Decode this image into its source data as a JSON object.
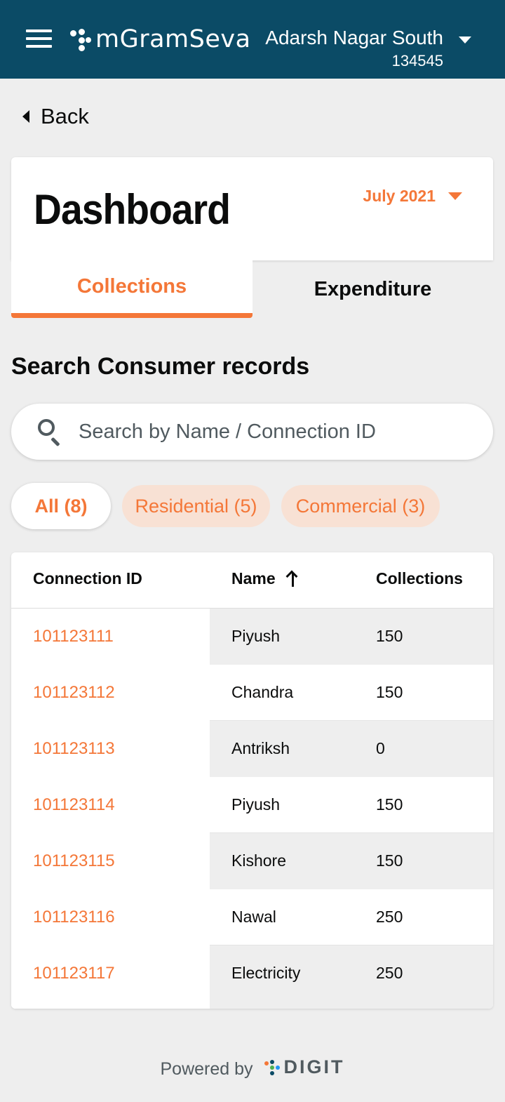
{
  "header": {
    "app_name": "mGramSeva",
    "tenant_name": "Adarsh Nagar South",
    "tenant_code": "134545"
  },
  "nav": {
    "back_label": "Back"
  },
  "dashboard": {
    "title": "Dashboard",
    "month": "July 2021"
  },
  "tabs": [
    {
      "label": "Collections",
      "active": true
    },
    {
      "label": "Expenditure",
      "active": false
    }
  ],
  "search": {
    "title": "Search Consumer records",
    "placeholder": "Search by Name / Connection ID"
  },
  "filters": [
    {
      "label": "All (8)",
      "selected": true
    },
    {
      "label": "Residential (5)",
      "selected": false
    },
    {
      "label": "Commercial (3)",
      "selected": false
    }
  ],
  "table": {
    "headers": {
      "connection_id": "Connection ID",
      "name": "Name",
      "collections": "Collections"
    },
    "sort": {
      "column": "Name",
      "direction": "ascending"
    },
    "rows": [
      {
        "connection_id": "101123111",
        "name": "Piyush",
        "collections": "150"
      },
      {
        "connection_id": "101123112",
        "name": "Chandra",
        "collections": "150"
      },
      {
        "connection_id": "101123113",
        "name": "Antriksh",
        "collections": "0"
      },
      {
        "connection_id": "101123114",
        "name": "Piyush",
        "collections": "150"
      },
      {
        "connection_id": "101123115",
        "name": "Kishore",
        "collections": "150"
      },
      {
        "connection_id": "101123116",
        "name": "Nawal",
        "collections": "250"
      },
      {
        "connection_id": "101123117",
        "name": "Electricity",
        "collections": "250"
      }
    ]
  },
  "footer": {
    "powered_by": "Powered by",
    "brand": "DIGIT"
  },
  "colors": {
    "header_bg": "#0b4b66",
    "accent": "#f47738",
    "chip_bg": "#f8e1d4",
    "page_bg": "#eeeeee"
  },
  "icons": [
    "menu-icon",
    "app-logo-icon",
    "chevron-down-icon",
    "back-caret-icon",
    "search-icon",
    "sort-arrow-up-icon",
    "digit-logo-icon"
  ]
}
